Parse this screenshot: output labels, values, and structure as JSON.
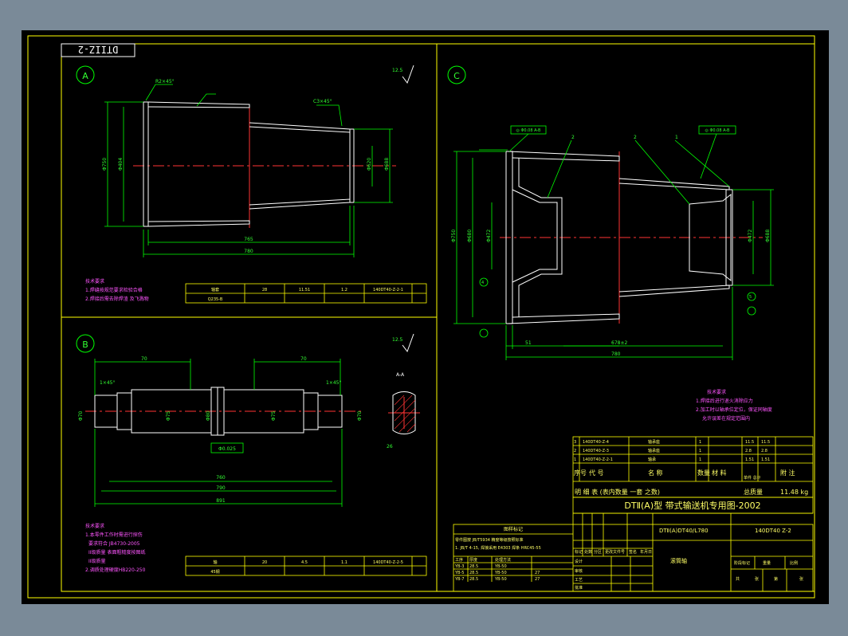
{
  "drawing": {
    "stamp_code": "DTIIZ-2",
    "colors": {
      "border": "#ffff00",
      "part": "#ffffff",
      "dimension": "#00ff00",
      "centerline": "#ff3333",
      "note": "#ff55ff",
      "table": "#ffff00"
    }
  },
  "view_a": {
    "label": "A",
    "roughness": "12.5",
    "dims": {
      "d1": "Φ750",
      "d2": "Φ404",
      "d3": "Φ620",
      "d4": "Φ688",
      "l1": "765",
      "l2": "780",
      "c1": "R2×45°",
      "c2": "C3×45°"
    },
    "notes_title": "技术要求",
    "notes": [
      "1.焊缝按规范要求检验合格",
      "2.焊接后需去除焊渣 及飞溅物"
    ],
    "table": [
      [
        "轴套",
        "28",
        "11.51",
        "1.2",
        "140DT40-Z-2-1",
        ""
      ],
      [
        "Q235-B",
        "",
        "",
        "",
        "",
        ""
      ]
    ]
  },
  "view_b": {
    "label": "B",
    "roughness": "12.5",
    "section_label": "A-A",
    "dims": {
      "len1": "70",
      "len2": "70",
      "total": "790",
      "overall": "891",
      "mid": "760",
      "key": "Φ60",
      "c1": "1×45°",
      "c2": "1×45°",
      "d1": "Φ70",
      "d2": "Φ75",
      "d3": "Φ80",
      "d4": "Φ75",
      "d5": "Φ70",
      "w": "26"
    },
    "tolerance_box": "Φ0.025",
    "notes_title": "技术要求",
    "notes": [
      "1.本零件工作时需进行探伤",
      "要求符合 JB4730-2005",
      "II级质量  表面粗糙度按图纸",
      "II级质量",
      "2.调质处理硬度HB220-250"
    ],
    "table": [
      [
        "轴",
        "20",
        "4.5",
        "1.1",
        "140DT40-Z-2-5",
        ""
      ],
      [
        "45钢",
        "",
        "",
        "",
        "",
        ""
      ]
    ]
  },
  "view_c": {
    "label": "C",
    "roughness": "12.5",
    "dims": {
      "d1": "Φ750",
      "d2": "Φ680",
      "d3": "Φ472",
      "d4": "Φ472",
      "d5": "Φ482",
      "d6": "Φ688",
      "l1": "51",
      "l2": "678±2",
      "l3": "780"
    },
    "balloons": [
      "1",
      "2",
      "3",
      "4",
      "5"
    ],
    "tol_boxes": [
      "◎ Φ0.08  A-B",
      "◎ Φ0.08  A-B"
    ],
    "notes_title": "技术要求",
    "notes": [
      "1.焊接后进行退火消除应力",
      "2.加工时以轴承位定位，保证同轴度",
      "允许误差在规定范围内"
    ]
  },
  "bom": {
    "rows": [
      [
        "3",
        "140DT40-Z-4",
        "轴承座",
        "1",
        "",
        "11.5",
        "11.5"
      ],
      [
        "2",
        "140DT40-Z-3",
        "轴承座",
        "1",
        "",
        "2.8",
        "2.8"
      ],
      [
        "1",
        "140DT40-Z-2-1",
        "轴承",
        "1",
        "",
        "1.51",
        "1.51"
      ]
    ],
    "header": [
      "序号",
      "代  号",
      "名  称",
      "数量",
      "材 料",
      "重量",
      "附 注"
    ],
    "weight_label": "单件  总计",
    "detail_title": "明  细  表  (表内数量  一套  之数)",
    "total_weight_label": "总质量",
    "total_weight": "11.48 kg"
  },
  "title_block": {
    "title": "DTⅡ(A)型 带式输送机专用图-2002",
    "model_code": "DTⅡ(A)DT40/L780",
    "drawing_no": "140DT40 Z-2",
    "part_name": "滚筒轴",
    "notice_title": "图样标记",
    "notice_lines": [
      "零件图按 JB/T5934 精度等级按照标准",
      "1. JB/T 4-15, 焊接采用 E4303 焊条 HRC45-55"
    ],
    "sub_rows": [
      [
        "工序",
        "厚度",
        "处理方法",
        ""
      ],
      [
        "YB-3",
        "28.5",
        "YB-50",
        ""
      ],
      [
        "YB-5",
        "28.5",
        "YB-50",
        "27"
      ],
      [
        "YB-7",
        "28.5",
        "YB-50",
        "27"
      ]
    ],
    "sign_labels": [
      "标记",
      "处数",
      "分区",
      "更改文件号",
      "签名",
      "年月日"
    ],
    "roles": [
      "设计",
      "审核",
      "工艺",
      "批准"
    ],
    "stage_labels": [
      "阶段标记",
      "重量",
      "比例"
    ],
    "sheet_labels": [
      "共",
      "张",
      "第",
      "张"
    ]
  }
}
